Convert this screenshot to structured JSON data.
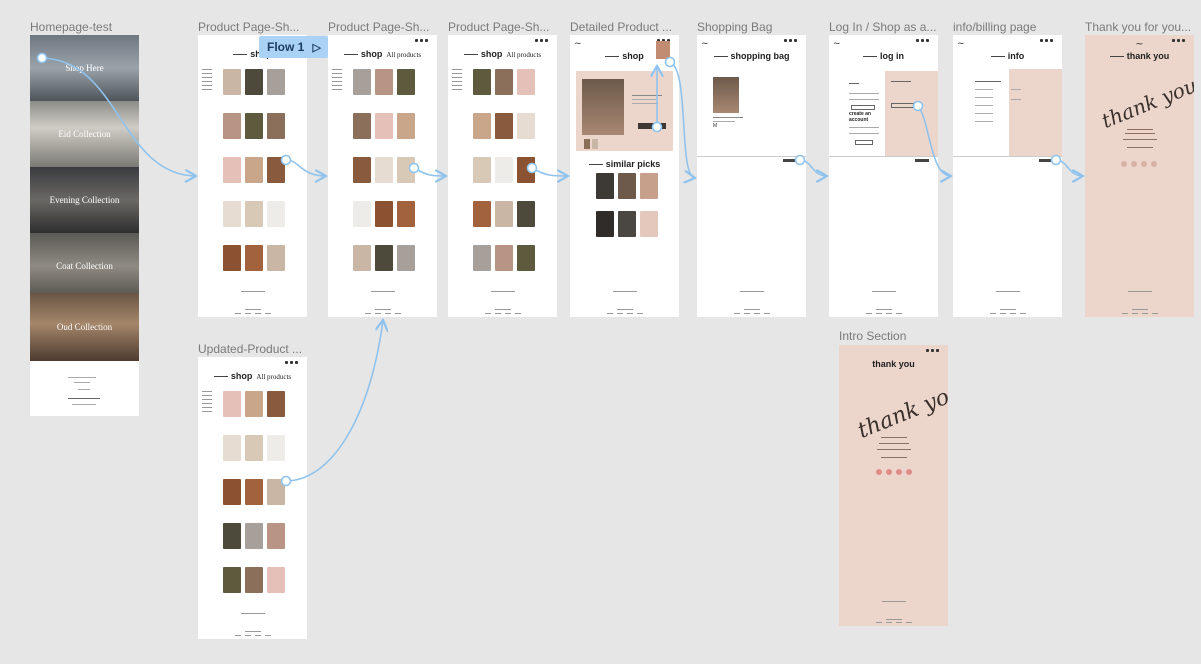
{
  "canvas": {
    "background": "#e6e6e6",
    "connector_color": "#8fc3ee"
  },
  "frames": [
    {
      "id": "homepage",
      "label": "Homepage-test"
    },
    {
      "id": "pp1",
      "label": "Product Page-Sh..."
    },
    {
      "id": "pp2",
      "label": "Product Page-Sh..."
    },
    {
      "id": "pp3",
      "label": "Product Page-Sh..."
    },
    {
      "id": "detail",
      "label": "Detailed Product ..."
    },
    {
      "id": "bag",
      "label": "Shopping Bag"
    },
    {
      "id": "login",
      "label": "Log In / Shop as a..."
    },
    {
      "id": "info",
      "label": "info/billing page"
    },
    {
      "id": "thanks",
      "label": "Thank you for you..."
    },
    {
      "id": "updated",
      "label": "Updated-Product ..."
    },
    {
      "id": "intro",
      "label": "Intro Section"
    }
  ],
  "flow": {
    "label": "Flow 1",
    "icon": "play-icon"
  },
  "homepage": {
    "heroes": [
      "Shop Here",
      "Eid Collection",
      "Evening Collection",
      "Coat Collection",
      "Oud Collection"
    ]
  },
  "pages": {
    "shop": "shop",
    "all_products": "All products",
    "shopping_bag": "shopping bag",
    "log_in": "log in",
    "info": "info",
    "thank_you": "thank you",
    "similar_picks": "similar picks",
    "create_account": "create an account"
  },
  "script_text": "thank you",
  "tile_colors": [
    "#c9b6a4",
    "#4d4a3c",
    "#a7a09a",
    "#b79483",
    "#5e5a3e",
    "#8b6f5a",
    "#e4c0b8",
    "#c9a68a",
    "#8a5a3c",
    "#e6dcd2",
    "#d8c8b6",
    "#eeece8",
    "#8a5230",
    "#a3623e"
  ]
}
